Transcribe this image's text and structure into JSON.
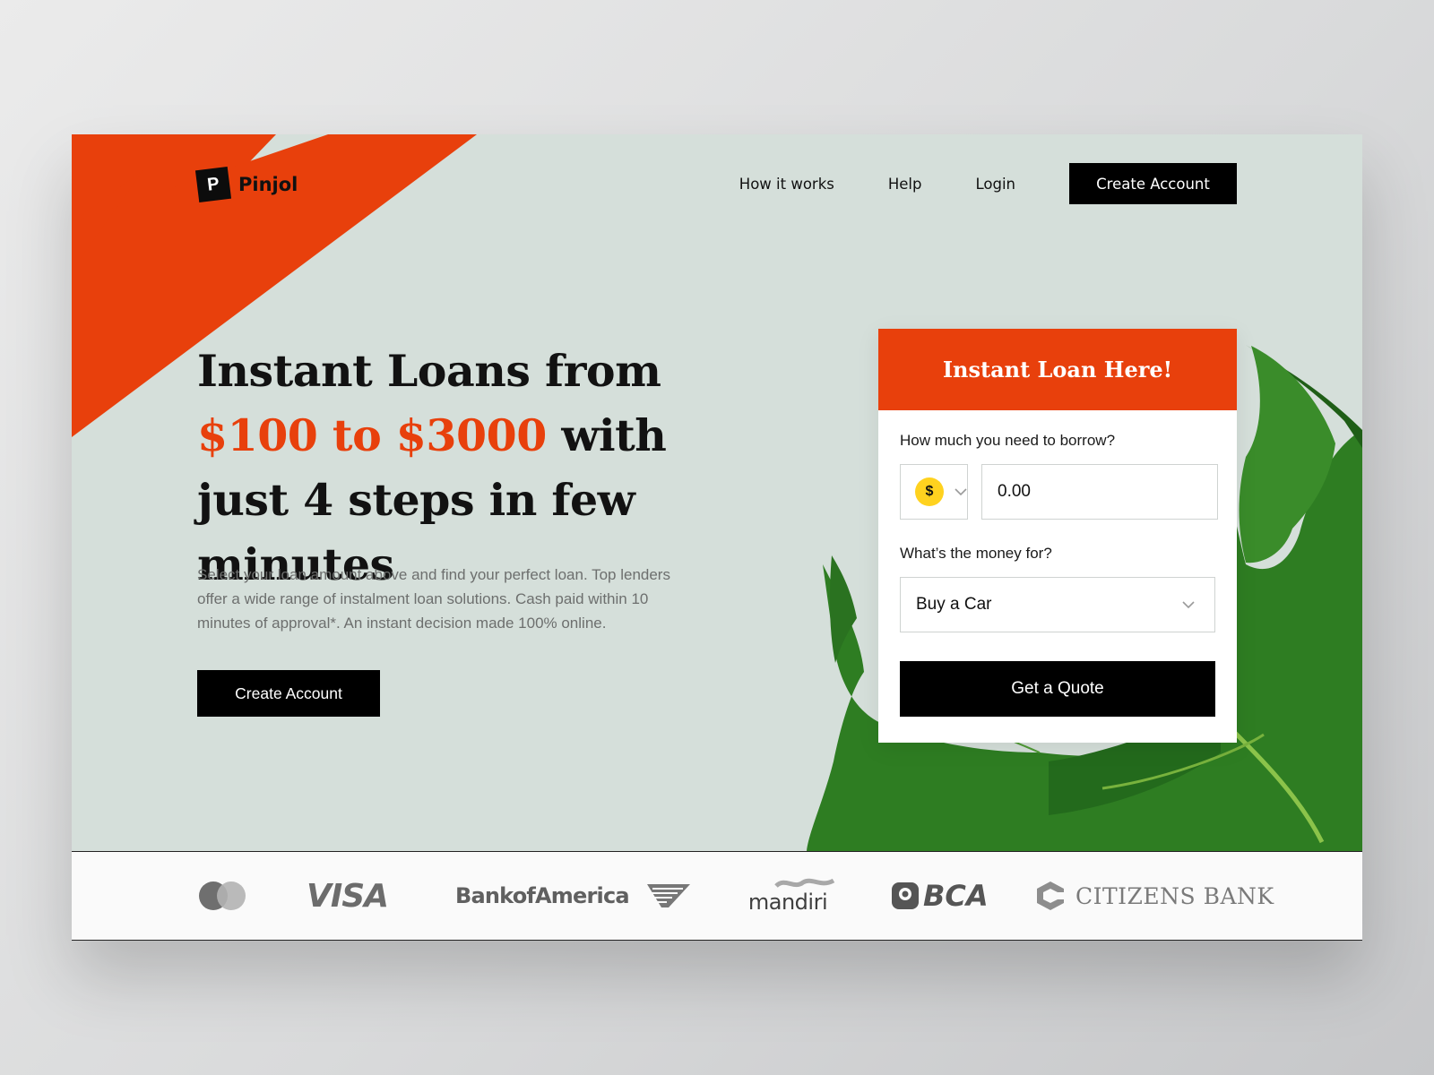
{
  "brand": {
    "logo_letter": "P",
    "name": "Pinjol"
  },
  "nav": {
    "links": [
      "How it works",
      "Help",
      "Login"
    ],
    "cta_label": "Create Account"
  },
  "hero": {
    "title_line1": "Instant Loans from",
    "title_accent": "$100 to $3000",
    "title_rest": " with just 4 steps in few minutes",
    "description": "Select your loan amount above and find your perfect loan. Top lenders offer a wide range of instalment loan solutions. Cash paid within 10 minutes of approval*. An instant decision made 100% online.",
    "cta_label": "Create Account"
  },
  "loan_form": {
    "header": "Instant Loan Here!",
    "amount_label": "How much you need to borrow?",
    "currency_symbol": "$",
    "amount_value": "0.00",
    "purpose_label": "What’s the money for?",
    "purpose_value": "Buy a Car",
    "submit_label": "Get a Quote"
  },
  "partners": {
    "visa": "VISA",
    "bank_of_america": "BankofAmerica",
    "mandiri": "mandiri",
    "bca": "BCA",
    "citizens": "CITIZENS BANK"
  },
  "colors": {
    "accent": "#e8400c",
    "hero_background": "#d5dfda",
    "dark": "#000000",
    "coin": "#ffd21f",
    "leaf": "#2e7d22"
  },
  "icons": {
    "currency_chevron": "chevron-down-icon",
    "purpose_chevron": "chevron-down-icon"
  }
}
